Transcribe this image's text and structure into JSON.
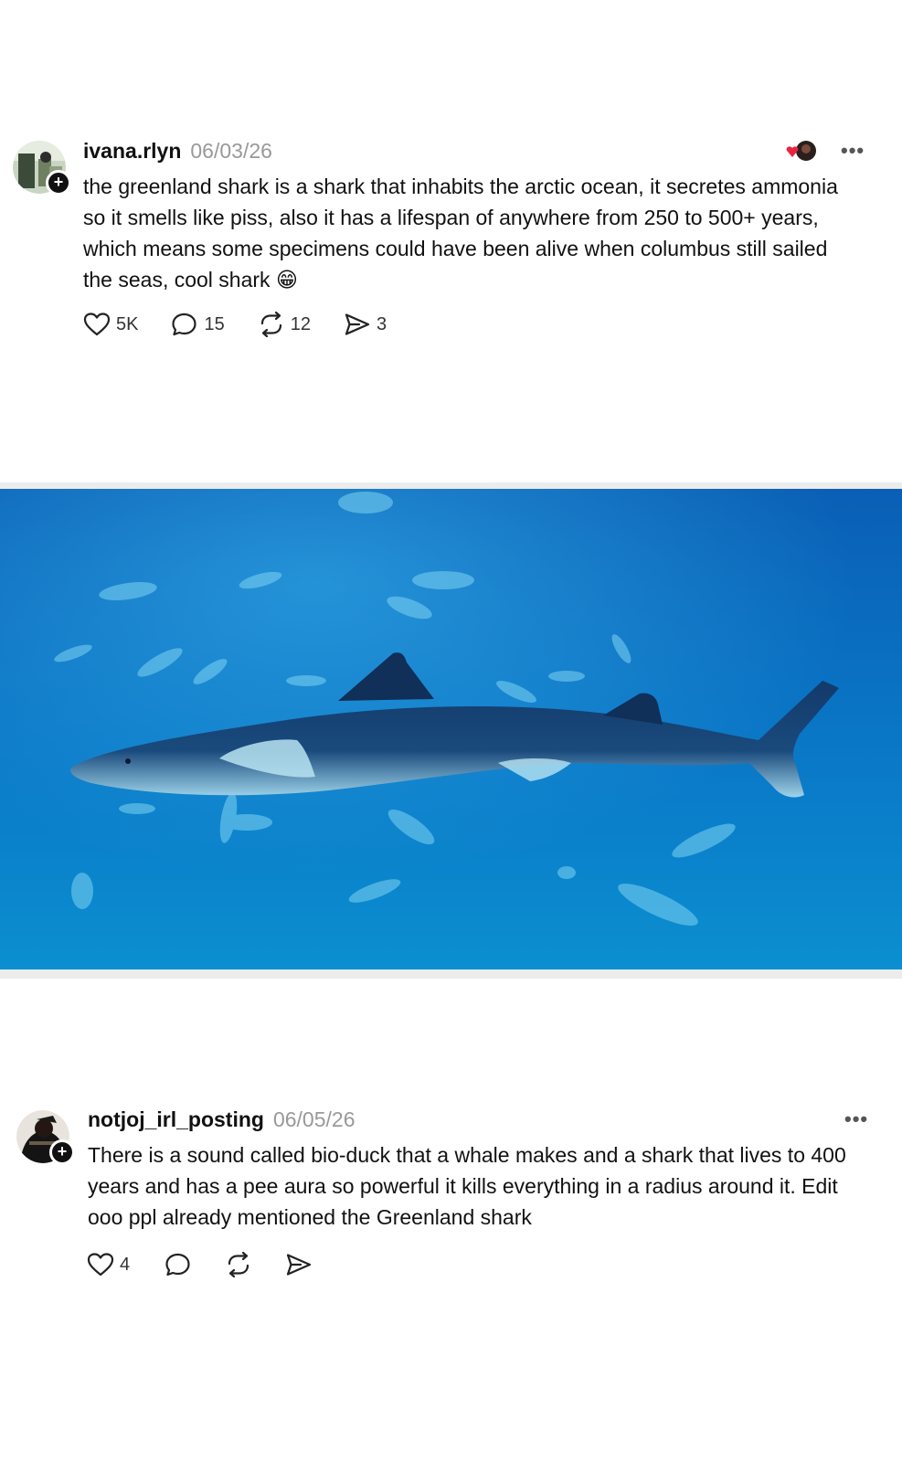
{
  "posts": [
    {
      "username": "ivana.rlyn",
      "date": "06/03/26",
      "text": "the greenland shark is a shark that inhabits the arctic ocean, it secretes ammonia so it smells like piss, also it has a lifespan of anywhere from 250 to 500+ years, which means some specimens could have been alive when columbus still sailed the seas, cool shark 😁",
      "likes": "5K",
      "comments": "15",
      "reposts": "12",
      "shares": "3",
      "more": "•••",
      "icons": [
        "avatar",
        "follow-plus-icon",
        "liked-by-avatars",
        "more-icon",
        "heart-icon",
        "comment-icon",
        "repost-icon",
        "share-icon"
      ]
    },
    {
      "username": "notjoj_irl_posting",
      "date": "06/05/26",
      "text": "There is a sound called bio-duck that a whale makes and a shark that lives to 400 years and has a pee aura so powerful it kills everything in a radius around it. Edit ooo ppl already mentioned the Greenland shark",
      "likes": "4",
      "more": "•••",
      "icons": [
        "avatar",
        "follow-plus-icon",
        "more-icon",
        "heart-icon",
        "comment-icon",
        "repost-icon",
        "share-icon"
      ]
    }
  ],
  "colors": {
    "text": "#111111",
    "muted": "#999999",
    "ocean_top": "#0a5fb5",
    "ocean_bottom": "#0b8fd0"
  }
}
